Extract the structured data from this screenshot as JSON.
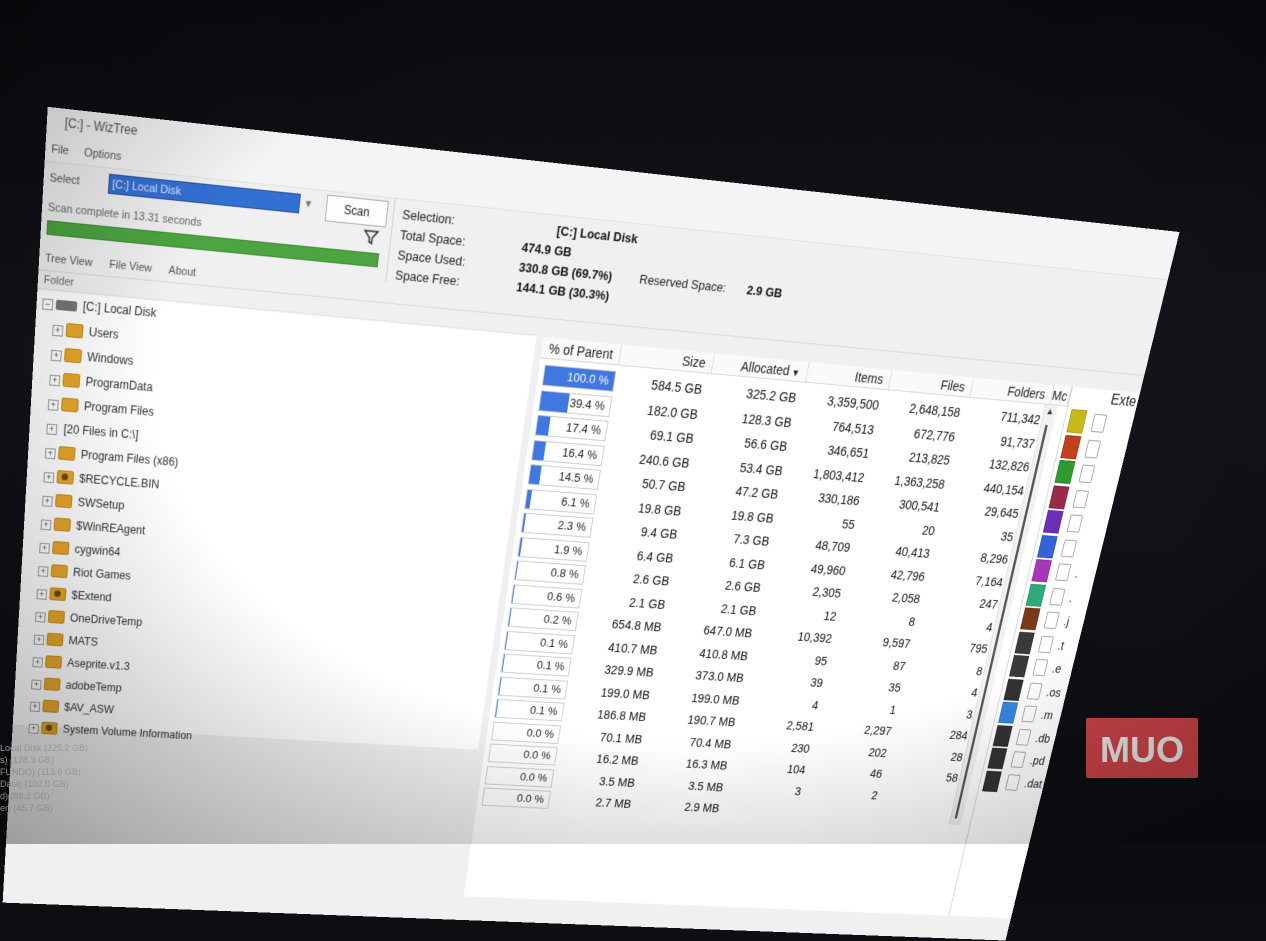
{
  "window": {
    "title": "[C:] - WizTree"
  },
  "menu": {
    "items": [
      "File",
      "Options"
    ]
  },
  "controls": {
    "select_label": "Select",
    "drive_value": "[C:] Local Disk",
    "scan_label": "Scan",
    "status": "Scan complete in 13.31 seconds",
    "progress": 1.0
  },
  "info": {
    "selection_label": "Selection:",
    "selection_value": "[C:]  Local Disk",
    "total_label": "Total Space:",
    "total_value": "474.9 GB",
    "used_label": "Space Used:",
    "used_value": "330.8 GB  (69.7%)",
    "free_label": "Space Free:",
    "free_value": "144.1 GB  (30.3%)",
    "reserved_label": "Reserved Space:",
    "reserved_value": "2.9 GB"
  },
  "tabs": [
    "Tree View",
    "File View",
    "About"
  ],
  "tree": {
    "header": "Folder",
    "root": "[C:] Local Disk",
    "items": [
      {
        "label": "Users",
        "icon": "folder"
      },
      {
        "label": "Windows",
        "icon": "folder"
      },
      {
        "label": "ProgramData",
        "icon": "folder"
      },
      {
        "label": "Program Files",
        "icon": "folder"
      },
      {
        "label": "[20 Files in C:\\]",
        "icon": "none"
      },
      {
        "label": "Program Files (x86)",
        "icon": "folder"
      },
      {
        "label": "$RECYCLE.BIN",
        "icon": "folder-special"
      },
      {
        "label": "SWSetup",
        "icon": "folder"
      },
      {
        "label": "$WinREAgent",
        "icon": "folder"
      },
      {
        "label": "cygwin64",
        "icon": "folder"
      },
      {
        "label": "Riot Games",
        "icon": "folder"
      },
      {
        "label": "$Extend",
        "icon": "folder-special"
      },
      {
        "label": "OneDriveTemp",
        "icon": "folder"
      },
      {
        "label": "MATS",
        "icon": "folder"
      },
      {
        "label": "Aseprite.v1.3",
        "icon": "folder"
      },
      {
        "label": "adobeTemp",
        "icon": "folder"
      },
      {
        "label": "$AV_ASW",
        "icon": "folder"
      },
      {
        "label": "System Volume Information",
        "icon": "folder-special"
      }
    ]
  },
  "grid": {
    "columns": [
      "% of Parent",
      "Size",
      "Allocated",
      "Items",
      "Files",
      "Folders",
      "Mc"
    ],
    "sort_icon": "sort-desc-icon",
    "rows": [
      {
        "pct": "100.0 %",
        "pct_val": 100.0,
        "size": "584.5 GB",
        "alloc": "325.2 GB",
        "items": "3,359,500",
        "files": "2,648,158",
        "folders": "711,342"
      },
      {
        "pct": "39.4 %",
        "pct_val": 39.4,
        "size": "182.0 GB",
        "alloc": "128.3 GB",
        "items": "764,513",
        "files": "672,776",
        "folders": "91,737"
      },
      {
        "pct": "17.4 %",
        "pct_val": 17.4,
        "size": "69.1 GB",
        "alloc": "56.6 GB",
        "items": "346,651",
        "files": "213,825",
        "folders": "132,826"
      },
      {
        "pct": "16.4 %",
        "pct_val": 16.4,
        "size": "240.6 GB",
        "alloc": "53.4 GB",
        "items": "1,803,412",
        "files": "1,363,258",
        "folders": "440,154"
      },
      {
        "pct": "14.5 %",
        "pct_val": 14.5,
        "size": "50.7 GB",
        "alloc": "47.2 GB",
        "items": "330,186",
        "files": "300,541",
        "folders": "29,645"
      },
      {
        "pct": "6.1 %",
        "pct_val": 6.1,
        "size": "19.8 GB",
        "alloc": "19.8 GB",
        "items": "55",
        "files": "20",
        "folders": "35"
      },
      {
        "pct": "2.3 %",
        "pct_val": 2.3,
        "size": "9.4 GB",
        "alloc": "7.3 GB",
        "items": "48,709",
        "files": "40,413",
        "folders": "8,296"
      },
      {
        "pct": "1.9 %",
        "pct_val": 1.9,
        "size": "6.4 GB",
        "alloc": "6.1 GB",
        "items": "49,960",
        "files": "42,796",
        "folders": "7,164"
      },
      {
        "pct": "0.8 %",
        "pct_val": 0.8,
        "size": "2.6 GB",
        "alloc": "2.6 GB",
        "items": "2,305",
        "files": "2,058",
        "folders": "247"
      },
      {
        "pct": "0.6 %",
        "pct_val": 0.6,
        "size": "2.1 GB",
        "alloc": "2.1 GB",
        "items": "12",
        "files": "8",
        "folders": "4"
      },
      {
        "pct": "0.2 %",
        "pct_val": 0.2,
        "size": "654.8 MB",
        "alloc": "647.0 MB",
        "items": "10,392",
        "files": "9,597",
        "folders": "795"
      },
      {
        "pct": "0.1 %",
        "pct_val": 0.1,
        "size": "410.7 MB",
        "alloc": "410.8 MB",
        "items": "95",
        "files": "87",
        "folders": "8"
      },
      {
        "pct": "0.1 %",
        "pct_val": 0.1,
        "size": "329.9 MB",
        "alloc": "373.0 MB",
        "items": "39",
        "files": "35",
        "folders": "4"
      },
      {
        "pct": "0.1 %",
        "pct_val": 0.1,
        "size": "199.0 MB",
        "alloc": "199.0 MB",
        "items": "4",
        "files": "1",
        "folders": "3"
      },
      {
        "pct": "0.1 %",
        "pct_val": 0.1,
        "size": "186.8 MB",
        "alloc": "190.7 MB",
        "items": "2,581",
        "files": "2,297",
        "folders": "284"
      },
      {
        "pct": "0.0 %",
        "pct_val": 0.0,
        "size": "70.1 MB",
        "alloc": "70.4 MB",
        "items": "230",
        "files": "202",
        "folders": "28"
      },
      {
        "pct": "0.0 %",
        "pct_val": 0.0,
        "size": "16.2 MB",
        "alloc": "16.3 MB",
        "items": "104",
        "files": "46",
        "folders": "58"
      },
      {
        "pct": "0.0 %",
        "pct_val": 0.0,
        "size": "3.5 MB",
        "alloc": "3.5 MB",
        "items": "3",
        "files": "2",
        "folders": ""
      },
      {
        "pct": "0.0 %",
        "pct_val": 0.0,
        "size": "2.7 MB",
        "alloc": "2.9 MB",
        "items": "",
        "files": "",
        "folders": ""
      }
    ]
  },
  "ext_pane": {
    "header": "Exte",
    "items": [
      {
        "color": "#c8b818",
        "icon": "blank-file-icon",
        "label": ""
      },
      {
        "color": "#c0421c",
        "icon": "settings-file-icon",
        "label": ""
      },
      {
        "color": "#2f9a2f",
        "icon": "blank-file-icon",
        "label": ""
      },
      {
        "color": "#9a2a4a",
        "icon": "document-file-icon",
        "label": ""
      },
      {
        "color": "#6a30b8",
        "icon": "image-file-icon",
        "label": ""
      },
      {
        "color": "#3562d8",
        "icon": "settings-file-icon",
        "label": ""
      },
      {
        "color": "#a638b8",
        "icon": "installer-file-icon",
        "label": "."
      },
      {
        "color": "#2fa87a",
        "icon": "installer-file-icon",
        "label": "."
      },
      {
        "color": "#7a3a18",
        "icon": "blank-file-icon",
        "label": ".j"
      },
      {
        "color": "#3a3a3a",
        "icon": "blank-file-icon",
        "label": ".t"
      },
      {
        "color": "#3a3a3a",
        "icon": "blank-file-icon",
        "label": ".e"
      },
      {
        "color": "#333333",
        "icon": "system-file-icon",
        "label": ".os"
      },
      {
        "color": "#3a85e0",
        "icon": "media-file-icon",
        "label": ".m"
      },
      {
        "color": "#333333",
        "icon": "settings-file-icon",
        "label": ".db"
      },
      {
        "color": "#333333",
        "icon": "blank-file-icon",
        "label": ".pd"
      },
      {
        "color": "#333333",
        "icon": "blank-file-icon",
        "label": ".dat"
      }
    ]
  },
  "status_strip": [
    "Local Disk  (325.2 GB)",
    "s) (128.3 GB)",
    "FUNDO) (113.6 GB)",
    "Data) (102.0 GB)",
    "d) (88.2 GB)",
    "er) (45.7 GB)"
  ],
  "watermark": {
    "text": "MUO",
    "color": "#e0494e"
  }
}
